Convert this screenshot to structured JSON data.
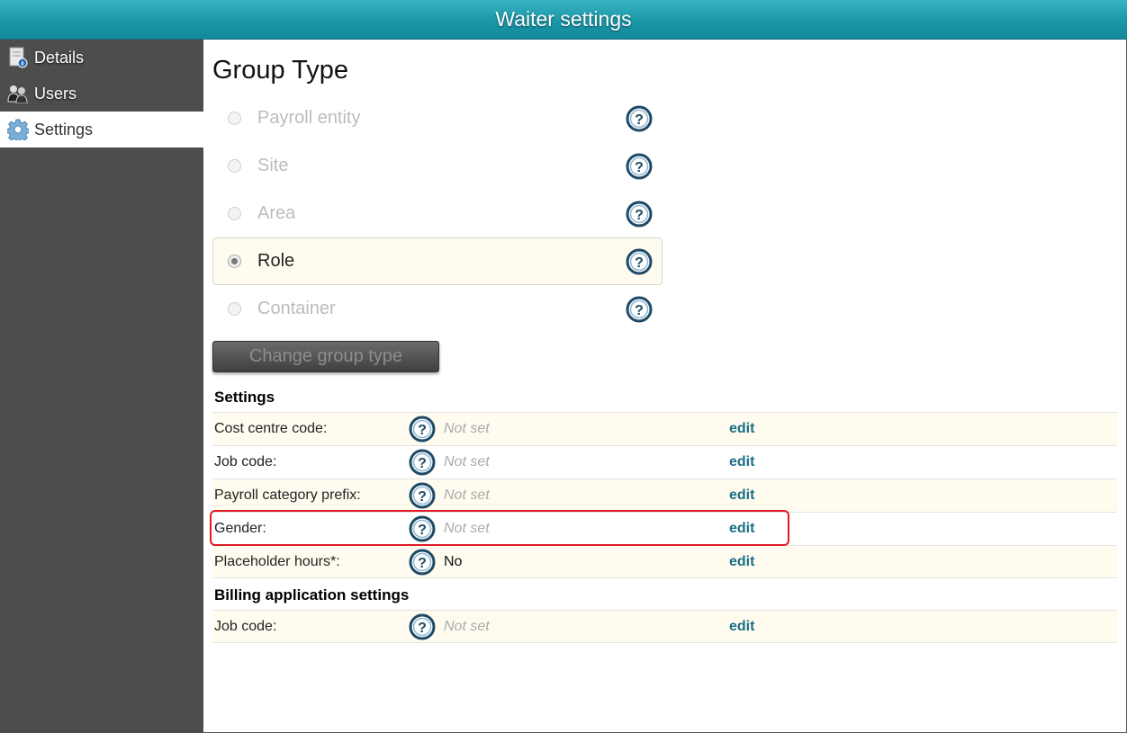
{
  "window": {
    "title": "Waiter settings"
  },
  "sidebar": {
    "items": [
      {
        "label": "Details",
        "icon": "details-icon",
        "active": false
      },
      {
        "label": "Users",
        "icon": "users-icon",
        "active": false
      },
      {
        "label": "Settings",
        "icon": "gear-icon",
        "active": true
      }
    ]
  },
  "group_type": {
    "heading": "Group Type",
    "options": [
      {
        "label": "Payroll entity",
        "selected": false
      },
      {
        "label": "Site",
        "selected": false
      },
      {
        "label": "Area",
        "selected": false
      },
      {
        "label": "Role",
        "selected": true
      },
      {
        "label": "Container",
        "selected": false
      }
    ],
    "change_button": "Change group type"
  },
  "settings": {
    "title": "Settings",
    "rows": [
      {
        "label": "Cost centre code:",
        "value": "Not set",
        "edit": "edit"
      },
      {
        "label": "Job code:",
        "value": "Not set",
        "edit": "edit"
      },
      {
        "label": "Payroll category prefix:",
        "value": "Not set",
        "edit": "edit"
      },
      {
        "label": "Gender:",
        "value": "Not set",
        "edit": "edit"
      },
      {
        "label": "Placeholder hours*:",
        "value": "No",
        "edit": "edit"
      }
    ]
  },
  "billing": {
    "title": "Billing application settings",
    "rows": [
      {
        "label": "Job code:",
        "value": "Not set",
        "edit": "edit"
      }
    ]
  },
  "colors": {
    "titlebar": "#1a97a8",
    "sidebar": "#4d4d4d",
    "row_highlight": "#fffcef",
    "edit_link": "#1a6f85",
    "annotation": "#e01b24"
  }
}
